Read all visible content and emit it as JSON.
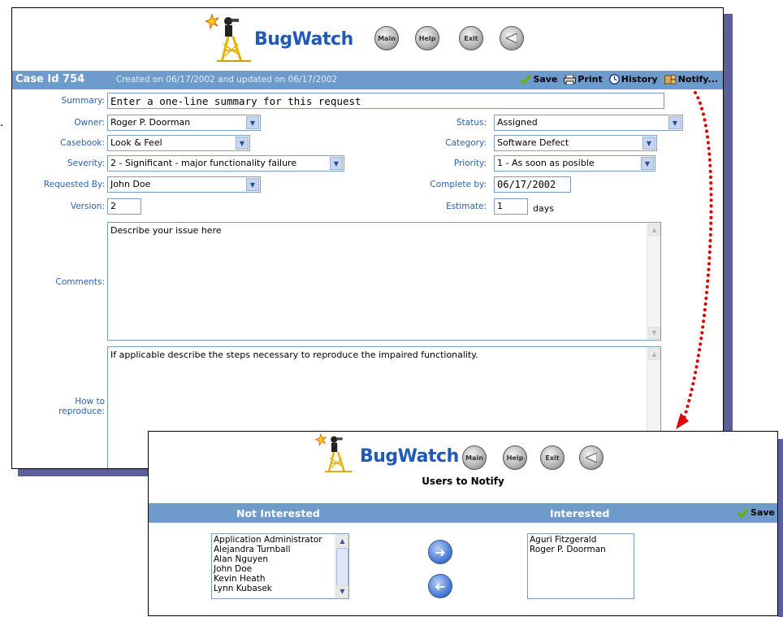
{
  "logo": {
    "text": "BugWatch"
  },
  "header_buttons": [
    "Main",
    "Help",
    "Exit"
  ],
  "margin_text": ".",
  "case_bar": {
    "case_id": "Case Id 754",
    "created": "Created on 06/17/2002 and updated on 06/17/2002",
    "actions": {
      "save": "Save",
      "print": "Print",
      "history": "History",
      "notify": "Notify..."
    }
  },
  "form": {
    "summary": {
      "label": "Summary:",
      "value": "Enter a one-line summary for this request"
    },
    "owner": {
      "label": "Owner:",
      "value": "Roger P. Doorman"
    },
    "status": {
      "label": "Status:",
      "value": "Assigned"
    },
    "casebook": {
      "label": "Casebook:",
      "value": "Look & Feel"
    },
    "category": {
      "label": "Category:",
      "value": "Software Defect"
    },
    "severity": {
      "label": "Severity:",
      "value": "2 - Significant - major functionality failure"
    },
    "priority": {
      "label": "Priority:",
      "value": "1 - As soon as posible"
    },
    "requested_by": {
      "label": "Requested By:",
      "value": "John Doe"
    },
    "complete_by": {
      "label": "Complete by:",
      "value": "06/17/2002"
    },
    "version": {
      "label": "Version:",
      "value": "2"
    },
    "estimate": {
      "label": "Estimate:",
      "value": "1",
      "unit": "days"
    },
    "comments": {
      "label": "Comments:",
      "value": "Describe your issue here"
    },
    "reproduce": {
      "label_line1": "How to",
      "label_line2": "reproduce:",
      "value": "If applicable describe the steps necessary to reproduce the impaired functionality."
    }
  },
  "notify_window": {
    "title": "Users to Notify",
    "not_interested_header": "Not Interested",
    "interested_header": "Interested",
    "save": "Save",
    "not_interested": [
      "Application Administrator",
      "Alejandra Turnball",
      "Alan Nguyen",
      "John Doe",
      "Kevin Heath",
      "Lynn Kubasek"
    ],
    "interested": [
      "Aguri Fitzgerald",
      "Roger P. Doorman"
    ]
  },
  "colors": {
    "bar": "#6e9bcb",
    "label": "#2a62a8",
    "logo": "#1f5ab8",
    "shadow": "#5b5f9d",
    "arrow": "#e00000"
  }
}
